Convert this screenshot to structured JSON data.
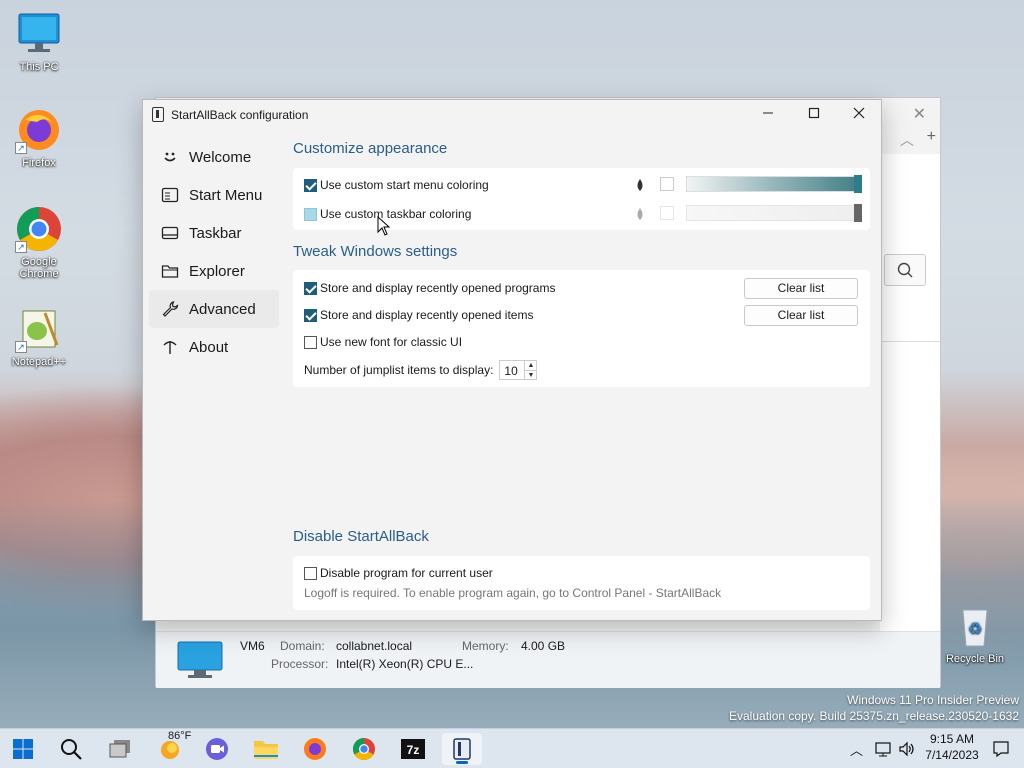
{
  "desktop": {
    "icons": [
      {
        "label": "This PC"
      },
      {
        "label": "Firefox"
      },
      {
        "label": "Google Chrome"
      },
      {
        "label": "Notepad++"
      },
      {
        "label": "Recycle Bin"
      }
    ],
    "watermark": {
      "line1": "Windows 11 Pro Insider Preview",
      "line2": "Evaluation copy. Build 25375.zn_release.230520-1632"
    }
  },
  "background_window": {
    "footer": {
      "pc_name": "VM6",
      "domain_label": "Domain:",
      "domain_value": "collabnet.local",
      "memory_label": "Memory:",
      "memory_value": "4.00 GB",
      "processor_label": "Processor:",
      "processor_value": "Intel(R) Xeon(R) CPU E..."
    }
  },
  "dialog": {
    "title": "StartAllBack configuration",
    "nav": [
      {
        "label": "Welcome",
        "icon": "smile-icon"
      },
      {
        "label": "Start Menu",
        "icon": "start-menu-icon"
      },
      {
        "label": "Taskbar",
        "icon": "taskbar-icon"
      },
      {
        "label": "Explorer",
        "icon": "folder-icon"
      },
      {
        "label": "Advanced",
        "icon": "wrench-icon",
        "active": true
      },
      {
        "label": "About",
        "icon": "antenna-icon"
      }
    ],
    "appearance": {
      "title": "Customize appearance",
      "start_menu_coloring": {
        "label": "Use custom start menu coloring",
        "checked": true
      },
      "taskbar_coloring": {
        "label": "Use custom taskbar coloring",
        "checked": false
      }
    },
    "tweak": {
      "title": "Tweak Windows settings",
      "recent_programs": {
        "label": "Store and display recently opened programs",
        "checked": true,
        "button": "Clear list"
      },
      "recent_items": {
        "label": "Store and display recently opened items",
        "checked": true,
        "button": "Clear list"
      },
      "new_font": {
        "label": "Use new font for classic UI",
        "checked": false
      },
      "jumplist": {
        "label": "Number of jumplist items to display:",
        "value": "10"
      }
    },
    "disable": {
      "title": "Disable StartAllBack",
      "checkbox": {
        "label": "Disable program for current user",
        "checked": false
      },
      "note": "Logoff is required. To enable program again, go to Control Panel - StartAllBack"
    }
  },
  "taskbar": {
    "weather": "86°F",
    "time": "9:15 AM",
    "date": "7/14/2023"
  },
  "colors": {
    "accent": "#1e5e7a",
    "section_title": "#2a5d8a",
    "taskbar_bg": "#dde6ee"
  }
}
